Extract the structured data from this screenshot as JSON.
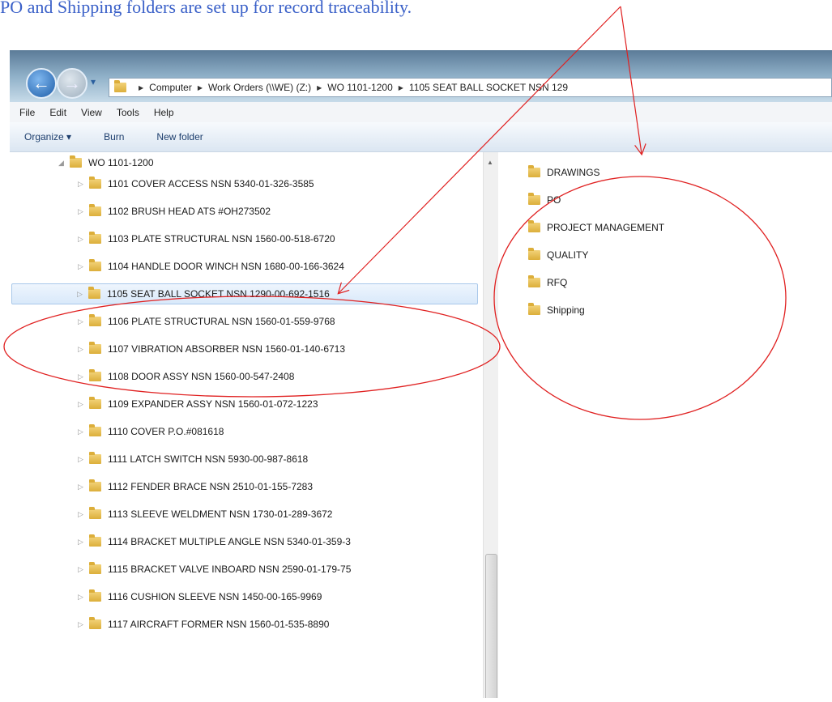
{
  "caption": "PO and Shipping folders are set up for record traceability.",
  "address_bar": {
    "crumbs": [
      "Computer",
      "Work Orders (\\\\WE) (Z:)",
      "WO 1101-1200",
      "1105 SEAT BALL SOCKET NSN 129"
    ]
  },
  "menu": [
    "File",
    "Edit",
    "View",
    "Tools",
    "Help"
  ],
  "toolbar": {
    "organize": "Organize ▾",
    "burn": "Burn",
    "new_folder": "New folder"
  },
  "tree": {
    "parent": "WO 1101-1200",
    "selected_index": 4,
    "items": [
      "1101 COVER ACCESS NSN 5340-01-326-3585",
      "1102 BRUSH HEAD ATS #OH273502",
      "1103 PLATE STRUCTURAL NSN 1560-00-518-6720",
      "1104 HANDLE DOOR WINCH NSN 1680-00-166-3624",
      "1105 SEAT BALL SOCKET NSN 1290-00-692-1516",
      "1106 PLATE STRUCTURAL NSN 1560-01-559-9768",
      "1107 VIBRATION ABSORBER NSN 1560-01-140-6713",
      "1108 DOOR ASSY NSN 1560-00-547-2408",
      "1109 EXPANDER ASSY NSN 1560-01-072-1223",
      "1110 COVER P.O.#081618",
      "1111 LATCH SWITCH NSN 5930-00-987-8618",
      "1112 FENDER BRACE NSN 2510-01-155-7283",
      "1113 SLEEVE WELDMENT NSN 1730-01-289-3672",
      "1114 BRACKET MULTIPLE ANGLE NSN 5340-01-359-3",
      "1115 BRACKET VALVE INBOARD NSN 2590-01-179-75",
      "1116 CUSHION SLEEVE NSN 1450-00-165-9969",
      "1117 AIRCRAFT FORMER NSN 1560-01-535-8890"
    ]
  },
  "content_folders": [
    "DRAWINGS",
    "PO",
    "PROJECT MANAGEMENT",
    "QUALITY",
    "RFQ",
    "Shipping"
  ],
  "colors": {
    "annotation": "#e02020",
    "caption": "#3a60c8",
    "selection": "#d9e9fa",
    "folder": "#dcae3a"
  },
  "icons": {
    "back": "arrow-left",
    "forward": "arrow-right",
    "folder": "folder",
    "expand": "triangle-right",
    "collapse": "triangle-down"
  }
}
